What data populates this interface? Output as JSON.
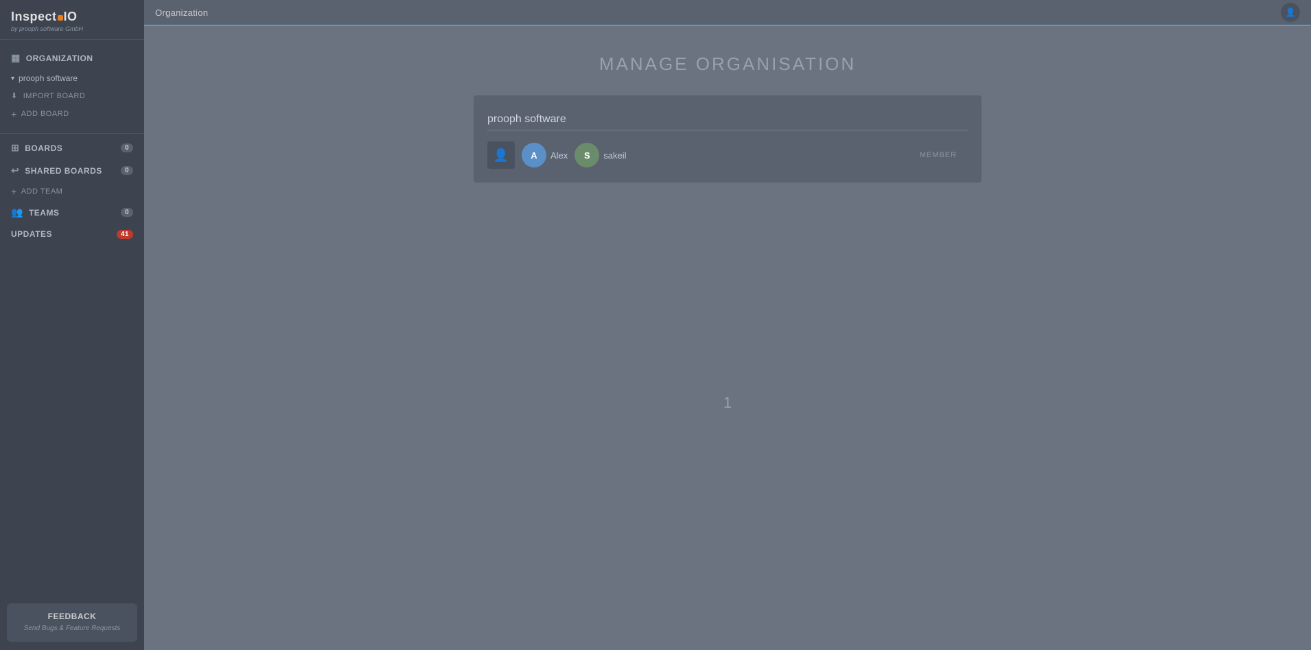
{
  "logo": {
    "title_part1": "Inspect",
    "title_part2": "IO",
    "subtitle": "by prooph software GmbH"
  },
  "sidebar": {
    "org_label": "ORGANIZATION",
    "org_name": "prooph software",
    "import_board": "IMPORT BOARD",
    "add_board": "ADD BOARD",
    "boards_label": "Boards",
    "boards_count": "0",
    "shared_boards_label": "Shared Boards",
    "shared_boards_count": "0",
    "add_team": "ADD TEAM",
    "teams_label": "Teams",
    "teams_count": "0",
    "updates_label": "Updates",
    "updates_count": "41"
  },
  "feedback": {
    "title": "FEEDBACK",
    "subtitle": "Send Bugs & Feature Requests"
  },
  "topbar": {
    "title": "Organization"
  },
  "main": {
    "page_title": "MANAGE ORGANISATION",
    "org_name": "prooph software",
    "member_label": "MEMBER",
    "member1_name": "Alex",
    "member2_name": "sakeil",
    "page_number": "1"
  }
}
